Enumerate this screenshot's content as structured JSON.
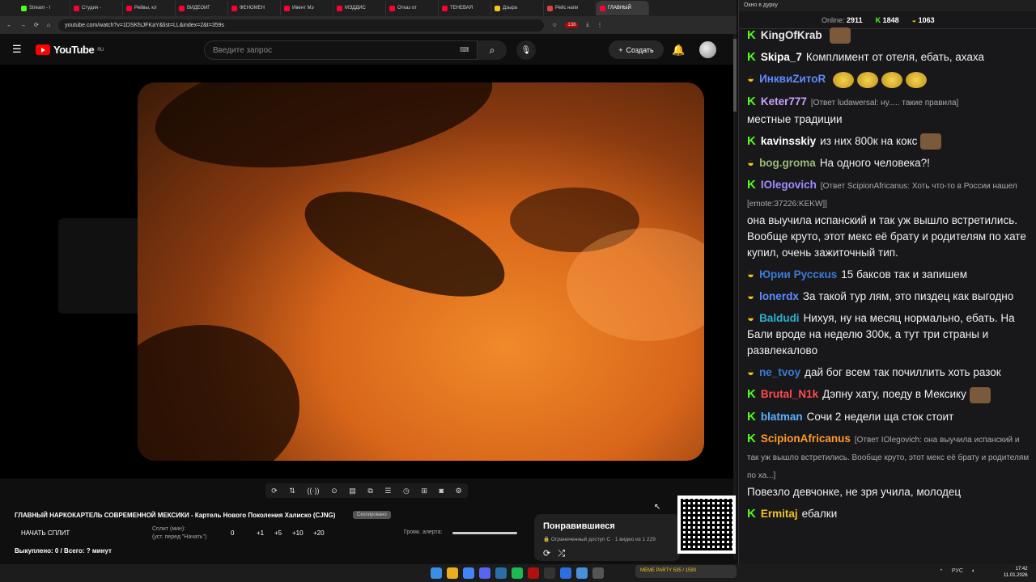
{
  "browser": {
    "tabs": [
      "Stream - l",
      "Студия -",
      "Рейвы, кл",
      "ВИДЕОИГ",
      "ФЕНОМЕН",
      "Ивент Мэ",
      "МЭДДИС",
      "Отказ от",
      "ТЕНЕВАЯ",
      "Дзыра",
      "Рейс напи",
      "ГЛАВНЫЙ"
    ],
    "url": "youtube.com/watch?v=1DSKfsJFKaY&list=LL&index=2&t=359s",
    "badge": "138"
  },
  "youtube": {
    "logo": "YouTube",
    "region": "RU",
    "search_placeholder": "Введите запрос",
    "create_label": "Создать"
  },
  "video": {
    "title": "ГЛАВНЫЙ НАРКОКАРТЕЛЬ СОВРЕМЕННОЙ МЕКСИКИ - Картель Нового Поколения Халиско (CJNG)",
    "badge": "Скопировано",
    "controls": [
      "⟳",
      "⇅",
      "((·))",
      "⊙",
      "▤",
      "⧉",
      "☰",
      "◷",
      "⊞",
      "◙",
      "⚙"
    ]
  },
  "split": {
    "start_label": "НАЧАТЬ СПЛИТ",
    "minutes_label": "Сплит (мин):",
    "minutes_hint": "(уст. перед \"Начать\")",
    "value": "0",
    "steps": [
      "+1",
      "+5",
      "+10",
      "+20"
    ],
    "alert_label": "Громк. алерта:",
    "bought": "Выкуплено: 0 / Всего: ? минут"
  },
  "liked": {
    "title": "Понравившиеся",
    "subtitle": "🔒 Ограниченный доступ  С · 1 видео из 1 229",
    "icons": [
      "⟳",
      "⤮"
    ]
  },
  "chat": {
    "window_title": "Окно в дурку",
    "online_label": "Online:",
    "online": "2911",
    "kick": "1848",
    "other": "1063",
    "messages": [
      {
        "user": "KingOfKrab",
        "color": "#e8e8e8",
        "k": true,
        "reply": "",
        "text": "",
        "emotes": 1
      },
      {
        "user": "Skipa_7",
        "color": "#ffffff",
        "k": true,
        "reply": "",
        "text": "Комплимент от отеля, ебать, ахаха",
        "emotes": 0
      },
      {
        "user": "ИнквиZитоR",
        "color": "#5b8cff",
        "k": false,
        "reply": "",
        "text": "",
        "emotes": 4
      },
      {
        "user": "Keter777",
        "color": "#c8a0ff",
        "k": true,
        "reply": "[Ответ ludawersal: ну..... такие правила]",
        "text": "местные традиции",
        "emotes": 0
      },
      {
        "user": "kavinsskiy",
        "color": "#ffffff",
        "k": true,
        "reply": "",
        "text": "из них 800к на кокс",
        "emotes": 1
      },
      {
        "user": "bog.groma",
        "color": "#9bb87a",
        "k": false,
        "reply": "",
        "text": "На одного человека?!",
        "emotes": 0
      },
      {
        "user": "IOlegovich",
        "color": "#9f8cff",
        "k": true,
        "reply": "[Ответ ScipionAfricanus: Хоть что-то в России нашел [emote:37226:KEKW]]",
        "text": "она выучила испанский и так уж вышло встретились. Вообще круто, этот мекс её брату и родителям по хате купил, очень зажиточный тип.",
        "emotes": 0
      },
      {
        "user": "Юрии Русскus",
        "color": "#3a7bd5",
        "k": false,
        "reply": "",
        "text": "15 баксов так и запишем",
        "emotes": 0
      },
      {
        "user": "lonerdx",
        "color": "#5b8cff",
        "k": false,
        "reply": "",
        "text": "За такой тур лям, это пиздец как выгодно",
        "emotes": 0
      },
      {
        "user": "Baldudi",
        "color": "#2ab0d0",
        "k": false,
        "reply": "",
        "text": "Нихуя, ну на месяц нормально, ебать. На Бали вроде на неделю 300к, а тут три страны и развлекалово",
        "emotes": 0
      },
      {
        "user": "ne_tvoy",
        "color": "#3a7bd5",
        "k": false,
        "reply": "",
        "text": "дай бог всем так почиллить хоть разок",
        "emotes": 0
      },
      {
        "user": "Brutal_N1k",
        "color": "#ff4a4a",
        "k": true,
        "reply": "",
        "text": "Дэпну хату, поеду в Мексику",
        "emotes": 1
      },
      {
        "user": "blatman",
        "color": "#5ab0ff",
        "k": true,
        "reply": "",
        "text": "Сочи 2 недели ща сток стоит",
        "emotes": 0
      },
      {
        "user": "ScipionAfricanus",
        "color": "#ff9a2a",
        "k": true,
        "reply": "[Ответ IOlegovich: она выучила испанский и так уж вышло встретились. Вообще круто, этот мекс её брату и родителям по ха...]",
        "text": "Повезло девчонке, не зря учила, молодец",
        "emotes": 0
      },
      {
        "user": "Ermitaj",
        "color": "#f0c020",
        "k": true,
        "reply": "",
        "text": "ебалки",
        "emotes": 0
      }
    ]
  },
  "taskbar": {
    "memes": "MEME PARTY  535 / 1590",
    "lang": "РУС",
    "time": "17:42",
    "date": "11.01.2026"
  },
  "colors": {
    "kick": "#53fc18",
    "yt_red": "#ff0000"
  }
}
